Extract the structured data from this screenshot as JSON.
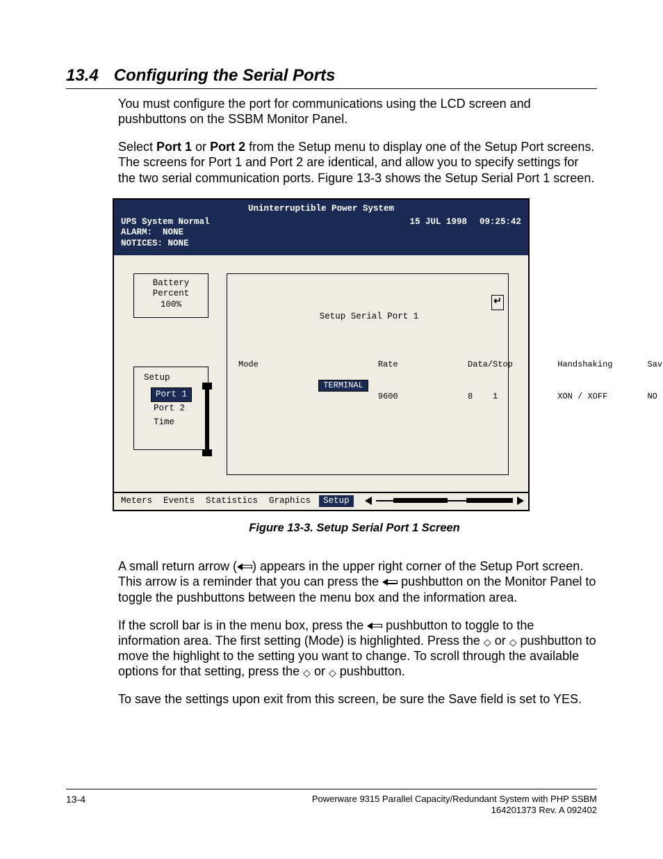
{
  "heading": {
    "number": "13.4",
    "title": "Configuring the Serial Ports"
  },
  "para1": "You must configure the port for communications using the LCD screen and pushbuttons on the SSBM Monitor Panel.",
  "para2a": "Select ",
  "para2b_bold": "Port 1",
  "para2c": " or ",
  "para2d_bold": "Port 2",
  "para2e": " from the Setup menu to display one of the Setup Port screens.  The screens for Port 1 and Port 2 are identical, and allow you to specify settings for the two serial communication ports.  Figure 13-3 shows the Setup Serial Port 1 screen.",
  "lcd": {
    "title": "Uninterruptible Power System",
    "status": "UPS System Normal",
    "date": "15 JUL 1998",
    "time": "09:25:42",
    "alarm_label": "ALARM:",
    "alarm_value": "NONE",
    "notices_label": "NOTICES:",
    "notices_value": "NONE",
    "battery": {
      "l1": "Battery",
      "l2": "Percent",
      "l3": "100%"
    },
    "setup_menu": {
      "title": "Setup",
      "items": [
        "Port 1",
        "Port 2",
        "Time"
      ],
      "selected_index": 0
    },
    "main": {
      "title": "Setup Serial Port 1",
      "columns": [
        {
          "hdr": "Mode",
          "val": "TERMINAL",
          "selected": true
        },
        {
          "hdr": "Rate",
          "val": "9600"
        },
        {
          "hdr": "Data/Stop",
          "val": "8    1"
        },
        {
          "hdr": "Handshaking",
          "val": "XON / XOFF"
        },
        {
          "hdr": "Save",
          "val": "NO"
        }
      ]
    },
    "menubar": {
      "tabs": [
        "Meters",
        "Events",
        "Statistics",
        "Graphics",
        "Setup"
      ],
      "active_index": 4
    }
  },
  "figcaption": "Figure 13-3.    Setup Serial Port 1 Screen",
  "para3a": "A small return arrow (",
  "para3b": ") appears in the upper right corner of the Setup Port screen.  This arrow is a reminder that you can press the ",
  "para3c": " pushbutton on the Monitor Panel to toggle the pushbuttons between the menu box and the information area.",
  "para4a": "If the scroll bar is in the menu box, press the ",
  "para4b": " pushbutton to toggle to the information area.  The first setting (Mode) is highlighted.  Press the ",
  "para4c": " or ",
  "para4d": " pushbutton to move the highlight to the setting you want to change.  To scroll through the available options for that setting, press the  ",
  "para4e": " or ",
  "para4f": " pushbutton.",
  "para5": "To save the settings upon exit from this screen, be sure the Save field is set to YES.",
  "footer": {
    "page": "13-4",
    "line1": "Powerware 9315 Parallel Capacity/Redundant System with PHP SSBM",
    "line2": "164201373   Rev. A     092402"
  }
}
